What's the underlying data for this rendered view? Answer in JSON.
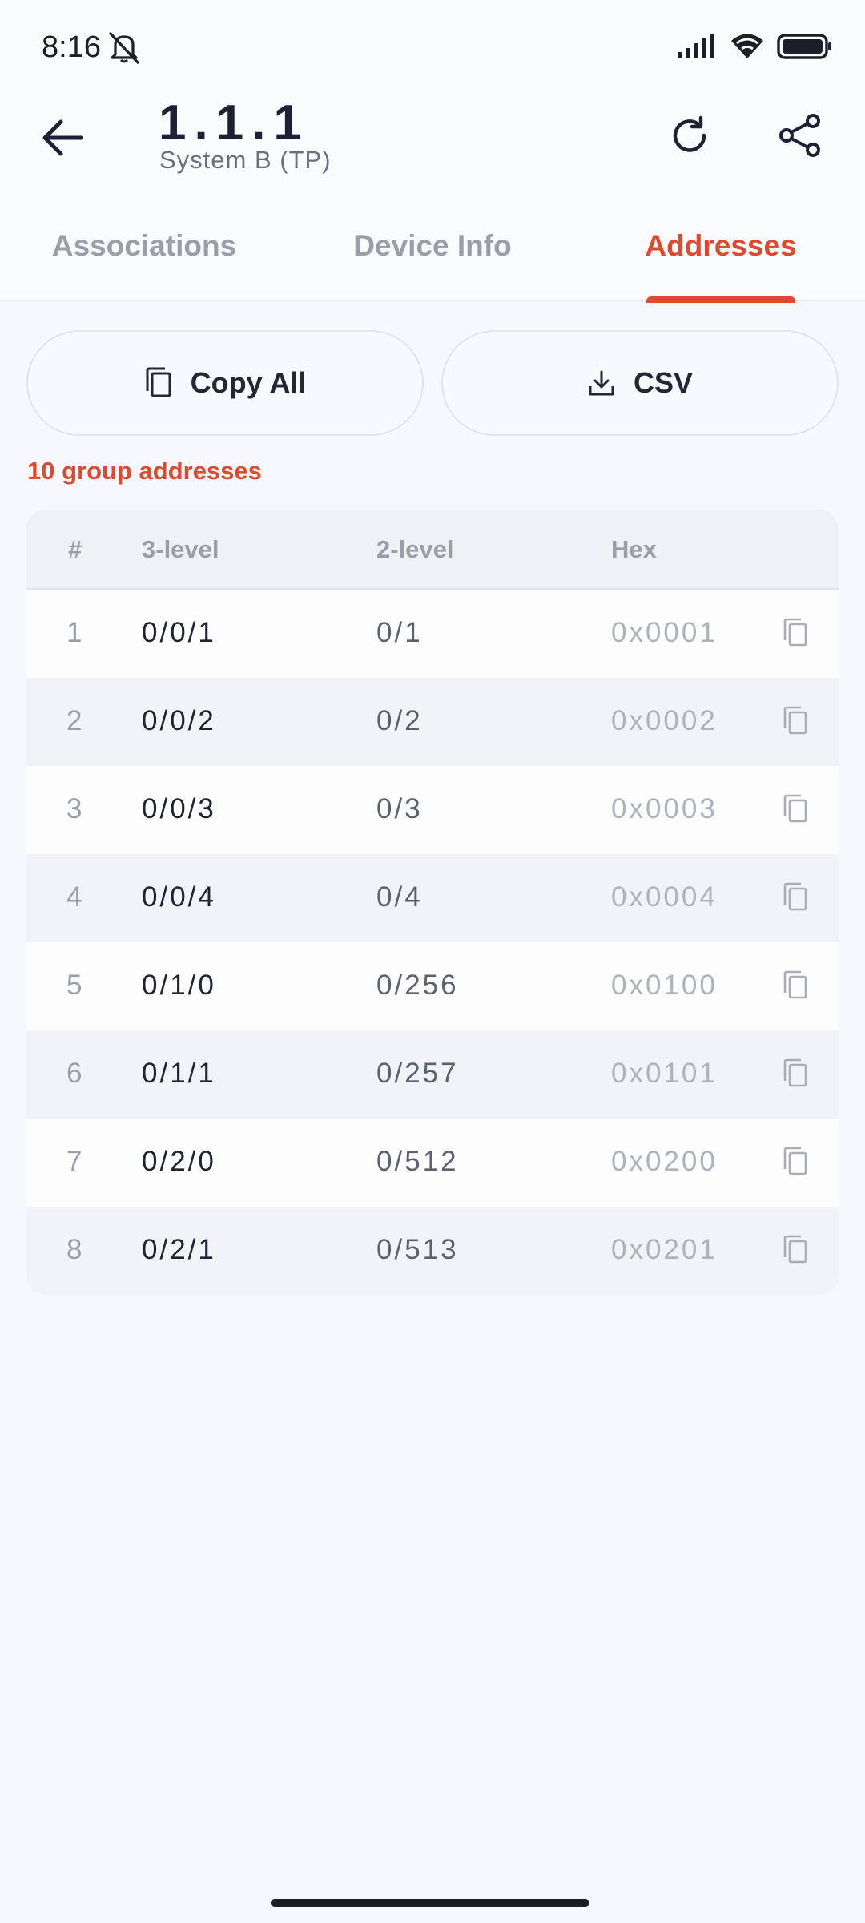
{
  "status_bar": {
    "time": "8:16",
    "icons": [
      "bell-off-icon",
      "signal-icon",
      "wifi-icon",
      "battery-icon"
    ]
  },
  "app_bar": {
    "title": "1.1.1",
    "subtitle": "System B (TP)",
    "icons": [
      "back-arrow-icon",
      "refresh-icon",
      "share-icon"
    ]
  },
  "tabs": [
    {
      "label": "Associations",
      "active": false
    },
    {
      "label": "Device Info",
      "active": false
    },
    {
      "label": "Addresses",
      "active": true
    }
  ],
  "actions": {
    "copy_all_label": "Copy All",
    "csv_label": "CSV"
  },
  "summary": {
    "count_label": "10 group addresses"
  },
  "table": {
    "headers": [
      "#",
      "3-level",
      "2-level",
      "Hex"
    ],
    "rows": [
      {
        "num": "1",
        "level3": "0/0/1",
        "level2": "0/1",
        "hex": "0x0001"
      },
      {
        "num": "2",
        "level3": "0/0/2",
        "level2": "0/2",
        "hex": "0x0002"
      },
      {
        "num": "3",
        "level3": "0/0/3",
        "level2": "0/3",
        "hex": "0x0003"
      },
      {
        "num": "4",
        "level3": "0/0/4",
        "level2": "0/4",
        "hex": "0x0004"
      },
      {
        "num": "5",
        "level3": "0/1/0",
        "level2": "0/256",
        "hex": "0x0100"
      },
      {
        "num": "6",
        "level3": "0/1/1",
        "level2": "0/257",
        "hex": "0x0101"
      },
      {
        "num": "7",
        "level3": "0/2/0",
        "level2": "0/512",
        "hex": "0x0200"
      },
      {
        "num": "8",
        "level3": "0/2/1",
        "level2": "0/513",
        "hex": "0x0201"
      }
    ]
  },
  "colors": {
    "accent": "#dc4a2f",
    "background": "#f7f8fc",
    "text": "#1c2230",
    "muted": "#9a9ea8"
  }
}
